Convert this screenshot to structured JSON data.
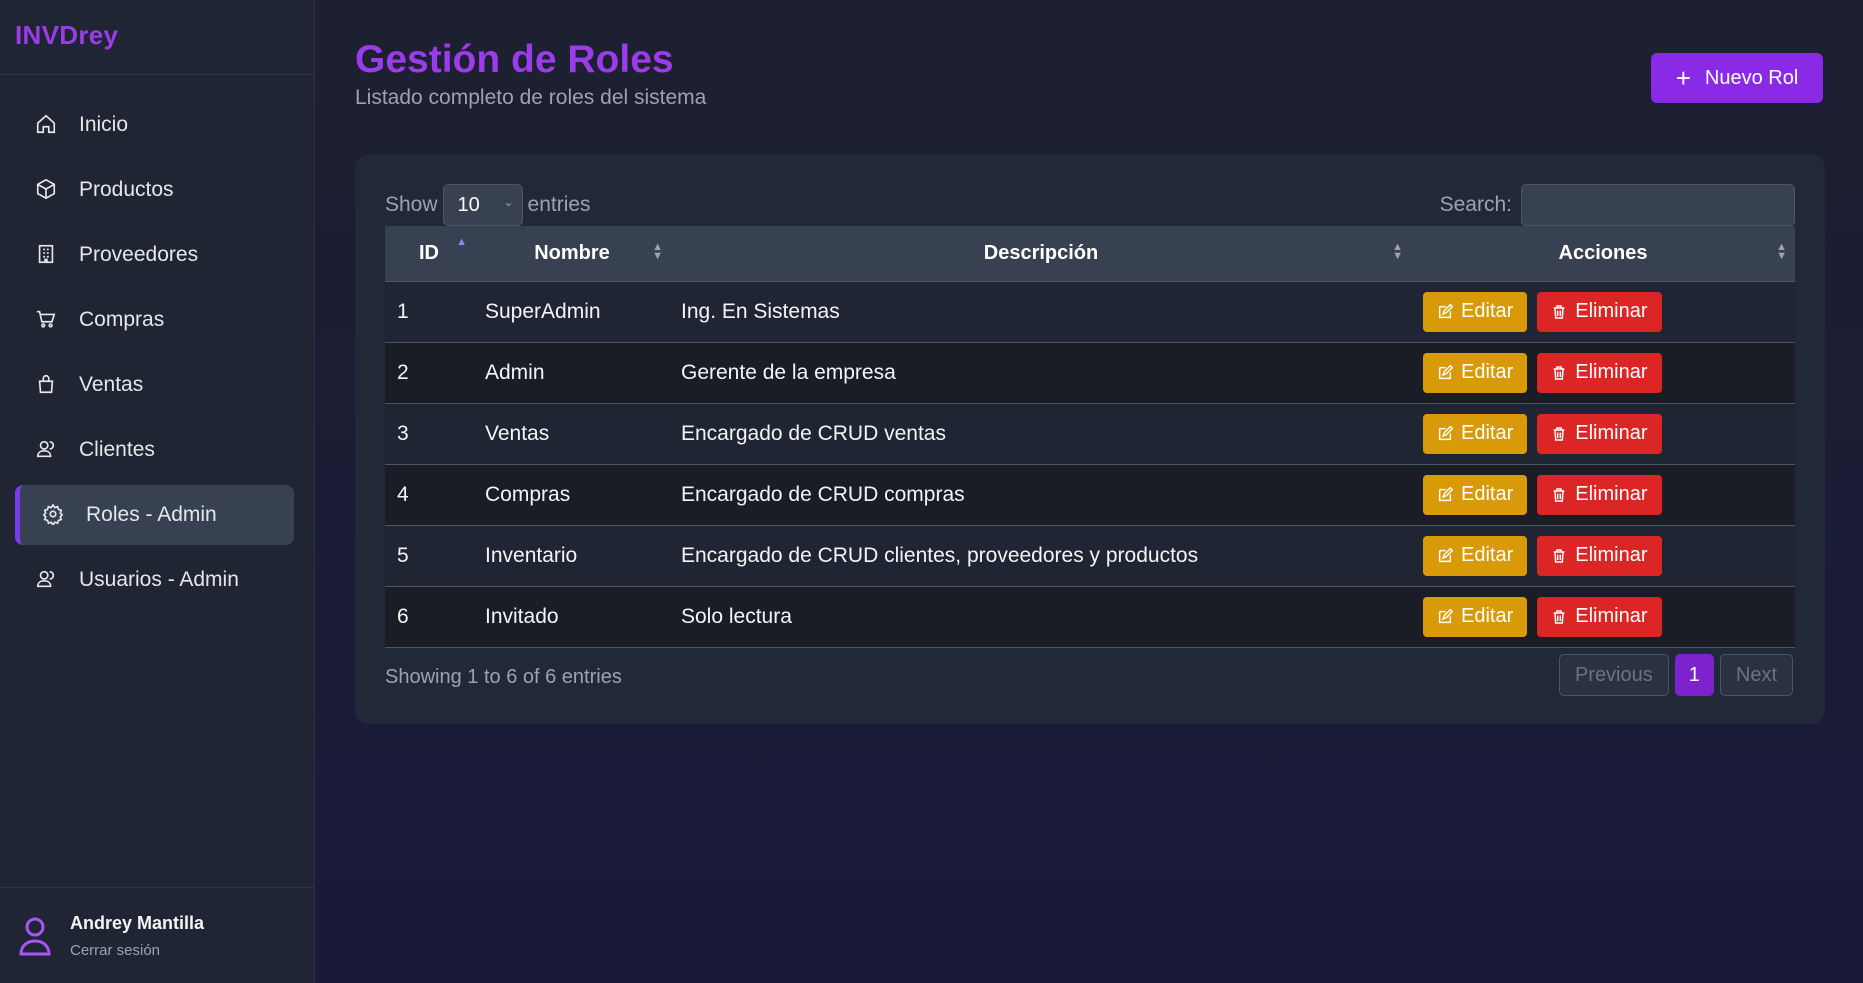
{
  "app": {
    "brand": "INVDrey"
  },
  "sidebar": {
    "items": [
      {
        "label": "Inicio",
        "icon": "home-icon"
      },
      {
        "label": "Productos",
        "icon": "box-icon"
      },
      {
        "label": "Proveedores",
        "icon": "building-icon"
      },
      {
        "label": "Compras",
        "icon": "cart-icon"
      },
      {
        "label": "Ventas",
        "icon": "bag-icon"
      },
      {
        "label": "Clientes",
        "icon": "users-icon"
      },
      {
        "label": "Roles - Admin",
        "icon": "gear-icon",
        "active": true
      },
      {
        "label": "Usuarios - Admin",
        "icon": "users-icon"
      }
    ],
    "user": {
      "name": "Andrey Mantilla",
      "logout": "Cerrar sesión"
    }
  },
  "header": {
    "title": "Gestión de Roles",
    "subtitle": "Listado completo de roles del sistema",
    "new_button": "Nuevo Rol"
  },
  "table_controls": {
    "show_label": "Show",
    "entries_value": "10",
    "entries_label": "entries",
    "search_label": "Search:",
    "search_value": ""
  },
  "table": {
    "columns": [
      "ID",
      "Nombre",
      "Descripción",
      "Acciones"
    ],
    "rows": [
      {
        "id": "1",
        "name": "SuperAdmin",
        "desc": "Ing. En Sistemas"
      },
      {
        "id": "2",
        "name": "Admin",
        "desc": "Gerente de la empresa"
      },
      {
        "id": "3",
        "name": "Ventas",
        "desc": "Encargado de CRUD ventas"
      },
      {
        "id": "4",
        "name": "Compras",
        "desc": "Encargado de CRUD compras"
      },
      {
        "id": "5",
        "name": "Inventario",
        "desc": "Encargado de CRUD clientes, proveedores y productos"
      },
      {
        "id": "6",
        "name": "Invitado",
        "desc": "Solo lectura"
      }
    ],
    "edit_label": "Editar",
    "delete_label": "Eliminar"
  },
  "footer": {
    "info": "Showing 1 to 6 of 6 entries",
    "prev": "Previous",
    "page": "1",
    "next": "Next"
  },
  "colors": {
    "accent": "#9b3bea",
    "edit": "#d89a09",
    "delete": "#dc2626"
  }
}
